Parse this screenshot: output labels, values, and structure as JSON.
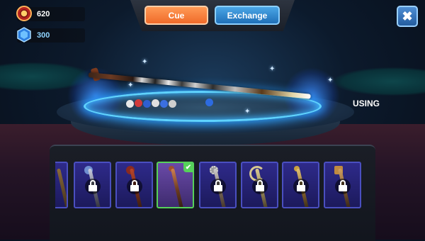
{
  "currencies": {
    "coins": {
      "value": "620",
      "icon": "coin-icon"
    },
    "gems": {
      "value": "300",
      "icon": "gem-icon"
    }
  },
  "tabs": [
    {
      "label": "Cue",
      "active": true
    },
    {
      "label": "Exchange",
      "active": false
    }
  ],
  "close": {
    "icon": "close-icon",
    "symbol": "✖"
  },
  "preview": {
    "status_label": "USING"
  },
  "colors": {
    "cue_tab": "#ef6a2a",
    "exchange_tab": "#1f6fb8",
    "selected_border": "#56d15a",
    "slot_bg": "#2e2a8a"
  },
  "cue_slots": [
    {
      "state": "partial",
      "locked": false
    },
    {
      "state": "locked",
      "locked": true,
      "icon": "lock-icon"
    },
    {
      "state": "locked",
      "locked": true,
      "icon": "lock-icon"
    },
    {
      "state": "selected",
      "locked": false,
      "icon": "check-icon",
      "check": "✔"
    },
    {
      "state": "locked",
      "locked": true,
      "icon": "lock-icon"
    },
    {
      "state": "locked",
      "locked": true,
      "icon": "lock-icon"
    },
    {
      "state": "locked",
      "locked": true,
      "icon": "lock-icon"
    },
    {
      "state": "locked",
      "locked": true,
      "icon": "lock-icon"
    }
  ]
}
